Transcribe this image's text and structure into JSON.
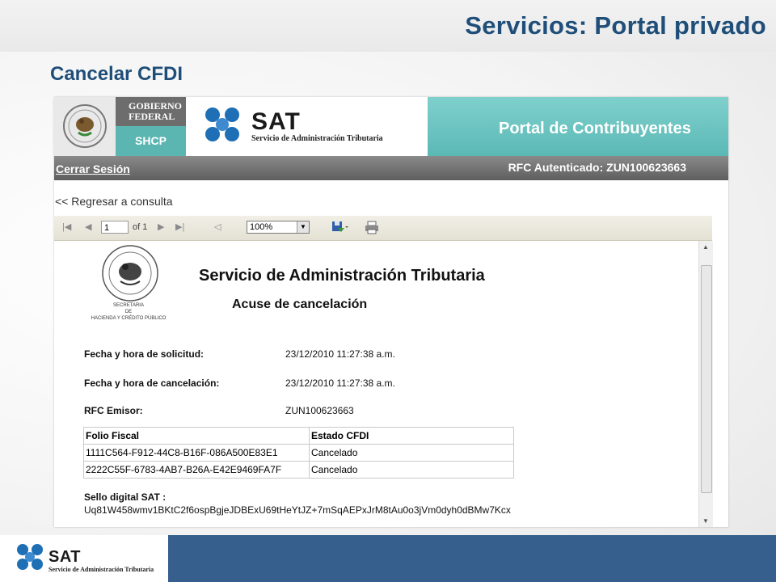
{
  "slide": {
    "title": "Servicios:  Portal privado",
    "subtitle": "Cancelar CFDI"
  },
  "portal": {
    "gobierno_line1": "GOBIERNO",
    "gobierno_line2": "FEDERAL",
    "shcp": "SHCP",
    "sat_name": "SAT",
    "sat_full": "Servicio de Administración Tributaria",
    "portal_title": "Portal de Contribuyentes",
    "logout_label": "Cerrar Sesión",
    "rfc_auth": "RFC Autenticado: ZUN100623663",
    "back_label": "<< Regresar a consulta"
  },
  "toolbar": {
    "page_value": "1",
    "page_of": "of 1",
    "zoom_value": "100%"
  },
  "report": {
    "title": "Servicio de Administración Tributaria",
    "subtitle": "Acuse de cancelación",
    "seal_line1": "SECRETARIA",
    "seal_line2": "DE",
    "seal_line3": "HACIENDA Y CRÉDITO PÚBLICO",
    "fields": [
      {
        "label": "Fecha y hora de solicitud:",
        "value": "23/12/2010 11:27:38 a.m."
      },
      {
        "label": "Fecha  y hora de cancelación:",
        "value": "23/12/2010 11:27:38 a.m."
      },
      {
        "label": "RFC Emisor:",
        "value": "ZUN100623663"
      }
    ],
    "table": {
      "headers": [
        "Folio Fiscal",
        "Estado CFDI"
      ],
      "rows": [
        [
          "1111C564-F912-44C8-B16F-086A500E83E1",
          "Cancelado"
        ],
        [
          "2222C55F-6783-4AB7-B26A-E42E9469FA7F",
          "Cancelado"
        ]
      ]
    },
    "sello_label": "Sello digital SAT :",
    "sello_value": "Uq81W458wmv1BKtC2f6ospBgjeJDBExU69tHeYtJZ+7mSqAEPxJrM8tAu0o3jVm0dyh0dBMw7Kcx"
  },
  "footer": {
    "sat_name": "SAT",
    "sat_full": "Servicio de Administración Tributaria"
  },
  "colors": {
    "title_blue": "#1f4e79",
    "teal": "#5bb9b5",
    "footer_blue": "#365f8e",
    "sat_dot_blue": "#1e6fb5"
  }
}
